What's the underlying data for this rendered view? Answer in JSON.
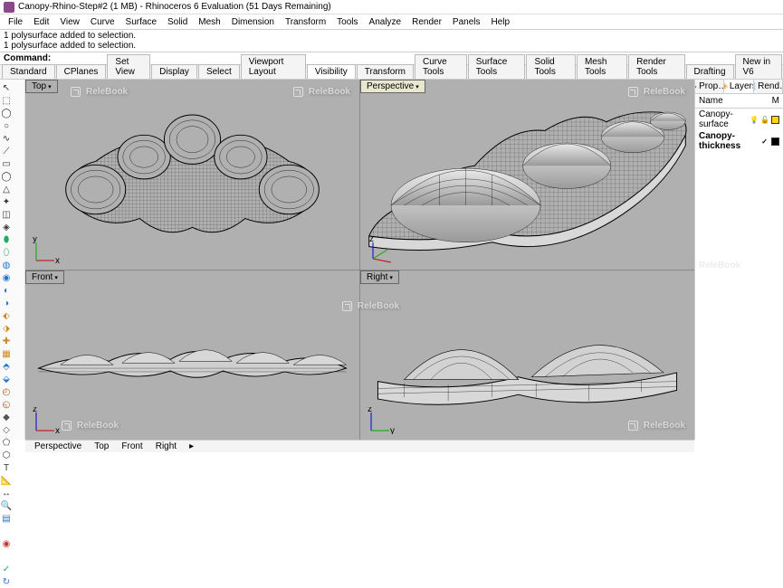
{
  "window": {
    "title": "Canopy-Rhino-Step#2 (1 MB) - Rhinoceros 6 Evaluation (51 Days Remaining)"
  },
  "menu": {
    "items": [
      "File",
      "Edit",
      "View",
      "Curve",
      "Surface",
      "Solid",
      "Mesh",
      "Dimension",
      "Transform",
      "Tools",
      "Analyze",
      "Render",
      "Panels",
      "Help"
    ]
  },
  "cmdlog": {
    "lines": [
      "1 polysurface added to selection.",
      "1 polysurface added to selection."
    ]
  },
  "cmdline": {
    "label": "Command:",
    "value": ""
  },
  "tabs": {
    "items": [
      "Standard",
      "CPlanes",
      "Set View",
      "Display",
      "Select",
      "Viewport Layout",
      "Visibility",
      "Transform",
      "Curve Tools",
      "Surface Tools",
      "Solid Tools",
      "Mesh Tools",
      "Render Tools",
      "Drafting",
      "New in V6"
    ],
    "active_index": 6
  },
  "toolbar_icons": [
    {
      "c": "#e0c040",
      "g": "💡"
    },
    {
      "c": "#e0c040",
      "g": "💡"
    },
    {
      "c": "#e0c040",
      "g": "💡"
    },
    {
      "c": "#e0c040",
      "g": "💡"
    },
    {
      "c": "#e0c040",
      "g": "💡"
    },
    {
      "c": "#e0c040",
      "g": "💡"
    },
    {
      "c": "#e0c040",
      "g": "•"
    },
    {
      "c": "#e0c040",
      "g": "◦"
    },
    {
      "c": "#e0c040",
      "g": "•"
    },
    {
      "c": "#e0c040",
      "g": "◦"
    },
    {
      "c": "#e0c040",
      "g": "💡"
    },
    {
      "c": "#e0c040",
      "g": "💡"
    },
    {
      "c": "#e0c040",
      "g": "💡"
    },
    {
      "c": "#e0c040",
      "g": "💡"
    },
    {
      "c": "#555",
      "g": "◧"
    },
    {
      "c": "#555",
      "g": "◨"
    },
    {
      "c": "#555",
      "g": "◫"
    },
    {
      "c": "#555",
      "g": "▦"
    },
    {
      "c": "#3a7",
      "g": "▣"
    },
    {
      "c": "#e33",
      "g": "✦"
    },
    {
      "c": "#e0c040",
      "g": "◇"
    },
    {
      "c": "#e0c040",
      "g": "◆"
    },
    {
      "c": "#e0c040",
      "g": "◇"
    }
  ],
  "left_tool_icons": [
    {
      "g": "↖",
      "c": "#333"
    },
    {
      "g": "⬚",
      "c": "#333"
    },
    {
      "g": "◯",
      "c": "#333"
    },
    {
      "g": "○",
      "c": "#333"
    },
    {
      "g": "∿",
      "c": "#333"
    },
    {
      "g": "⟋",
      "c": "#333"
    },
    {
      "g": "▭",
      "c": "#333"
    },
    {
      "g": "◯",
      "c": "#333"
    },
    {
      "g": "△",
      "c": "#333"
    },
    {
      "g": "✦",
      "c": "#333"
    },
    {
      "g": "◫",
      "c": "#333"
    },
    {
      "g": "◈",
      "c": "#333"
    },
    {
      "g": "⬮",
      "c": "#2a6"
    },
    {
      "g": "⬯",
      "c": "#2a6"
    },
    {
      "g": "◍",
      "c": "#27c"
    },
    {
      "g": "◉",
      "c": "#27c"
    },
    {
      "g": "◐",
      "c": "#27c"
    },
    {
      "g": "◑",
      "c": "#27c"
    },
    {
      "g": "⬖",
      "c": "#c82"
    },
    {
      "g": "⬗",
      "c": "#c82"
    },
    {
      "g": "✚",
      "c": "#c82"
    },
    {
      "g": "▦",
      "c": "#c82"
    },
    {
      "g": "⬘",
      "c": "#27c"
    },
    {
      "g": "⬙",
      "c": "#27c"
    },
    {
      "g": "◴",
      "c": "#a52"
    },
    {
      "g": "◵",
      "c": "#a52"
    },
    {
      "g": "◆",
      "c": "#555"
    },
    {
      "g": "◇",
      "c": "#555"
    },
    {
      "g": "⬠",
      "c": "#333"
    },
    {
      "g": "⬡",
      "c": "#333"
    },
    {
      "g": "T",
      "c": "#333"
    },
    {
      "g": "📐",
      "c": "#333"
    },
    {
      "g": "↔",
      "c": "#333"
    },
    {
      "g": "🔍",
      "c": "#333"
    },
    {
      "g": "▤",
      "c": "#27c"
    },
    {
      "g": "",
      "c": "#333"
    },
    {
      "g": "◉",
      "c": "#c33"
    },
    {
      "g": "",
      "c": "#333"
    },
    {
      "g": "✓",
      "c": "#2a6"
    },
    {
      "g": "↻",
      "c": "#27c"
    }
  ],
  "viewports": {
    "top": {
      "label": "Top"
    },
    "perspective": {
      "label": "Perspective"
    },
    "front": {
      "label": "Front"
    },
    "right": {
      "label": "Right"
    },
    "active": "perspective"
  },
  "sidepanel": {
    "tabs": [
      {
        "label": "Prop…",
        "icon": "◒",
        "ic": "#d33"
      },
      {
        "label": "Layers",
        "icon": "◈",
        "ic": "#d93"
      },
      {
        "label": "Rend…",
        "icon": "▣",
        "ic": "#6ad"
      }
    ],
    "active_tab": 1,
    "columns": {
      "name": "Name",
      "meta": "M"
    },
    "layers": [
      {
        "name": "Canopy-surface",
        "visible": true,
        "locked": false,
        "color": "#ffd400",
        "selected": false,
        "on": "💡",
        "lock": "🔓"
      },
      {
        "name": "Canopy-thickness",
        "visible": true,
        "locked": false,
        "color": "#000000",
        "selected": true,
        "on": "✓",
        "lock": ""
      }
    ]
  },
  "bottom_tabs": {
    "items": [
      "Perspective",
      "Top",
      "Front",
      "Right"
    ],
    "arrow": "▸"
  },
  "watermark": {
    "text": "ReleBook"
  }
}
